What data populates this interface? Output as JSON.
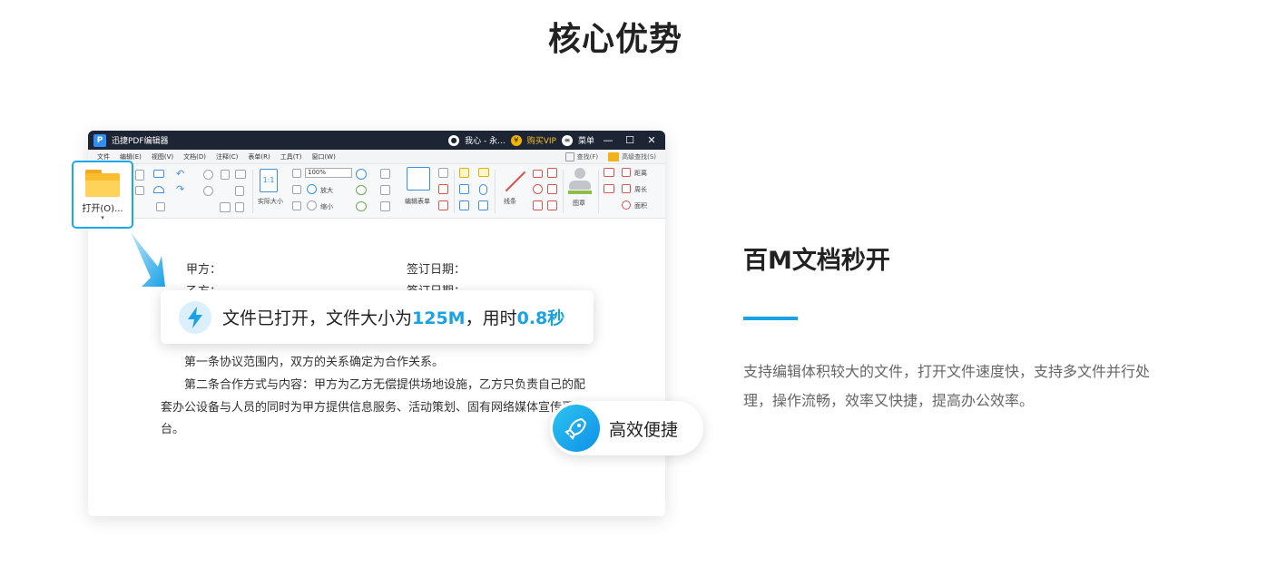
{
  "section_title": "核心优势",
  "app": {
    "logo_letter": "P",
    "window_title": "迅捷PDF编辑器",
    "user_label": "我心 - 永...",
    "vip_icon_glyph": "¥",
    "vip_label": "购买VIP",
    "menu_label": "菜单",
    "menubar": [
      "文件",
      "编辑(E)",
      "视图(V)",
      "文档(D)",
      "注释(C)",
      "表单(R)",
      "工具(T)",
      "窗口(W)"
    ],
    "find_label": "查找(F)",
    "advanced_find_label": "高级查找(S)",
    "ribbon": {
      "zoom_value": "100%",
      "actual_size": "实际大小",
      "zoom_in": "放大",
      "zoom_out": "缩小",
      "edit_form": "编辑表单",
      "line": "线条",
      "stamp": "图章",
      "distance": "距离",
      "perimeter": "周长",
      "area": "面积",
      "actual_size_icon_text": "1:1"
    }
  },
  "open_button": {
    "label": "打开(O)..."
  },
  "document": {
    "party_a": "甲方：",
    "sign_date_1": "签订日期：",
    "party_b": "乙方：",
    "sign_date_2": "签订日期：",
    "clause_1": "第一条协议范围内，双方的关系确定为合作关系。",
    "clause_2_line1": "第二条合作方式与内容：甲方为乙方无偿提供场地设施，乙方只负责自己的配",
    "clause_2_line2": "套办公设备与人员的同时为甲方提供信息服务、活动策划、固有网络媒体宣传平",
    "clause_2_line3": "台。"
  },
  "toast": {
    "text_1": "文件已打开，文件大小为",
    "size": "125M",
    "text_2": "，用时",
    "time": "0.8秒"
  },
  "badge": {
    "label": "高效便捷"
  },
  "feature": {
    "title": "百M文档秒开",
    "description": "支持编辑体积较大的文件，打开文件速度快，支持多文件并行处理，操作流畅，效率又快捷，提高办公效率。"
  },
  "colors": {
    "accent": "#1aa1e6",
    "titlebar": "#1d2433",
    "folder": "#f9bd2f"
  }
}
